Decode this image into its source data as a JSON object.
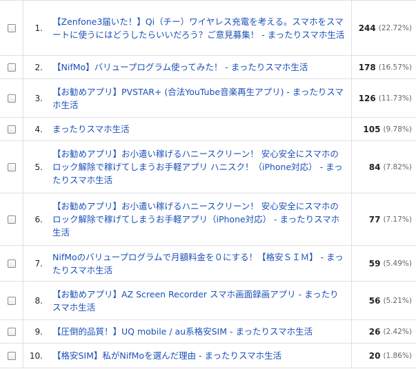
{
  "rows": [
    {
      "rank": "1.",
      "title": "【Zenfone3届いた！】Qi（チー）ワイヤレス充電を考える。スマホをスマートに使うにはどうしたらいいだろう？ご意見募集！ - まったりスマホ生活",
      "value": "244",
      "percent": "(22.72%)"
    },
    {
      "rank": "2.",
      "title": "【NifMo】バリュープログラム使ってみた！ - まったりスマホ生活",
      "value": "178",
      "percent": "(16.57%)"
    },
    {
      "rank": "3.",
      "title": "【お勧めアプリ】PVSTAR+ (合法YouTube音楽再生アプリ) - まったりスマホ生活",
      "value": "126",
      "percent": "(11.73%)"
    },
    {
      "rank": "4.",
      "title": "まったりスマホ生活",
      "value": "105",
      "percent": "(9.78%)"
    },
    {
      "rank": "5.",
      "title": "【お勧めアプリ】お小遣い稼げるハニースクリーン！ 安心安全にスマホのロック解除で稼げてしまうお手軽アプリ ハニスク！（iPhone対応） - まったりスマホ生活",
      "value": "84",
      "percent": "(7.82%)"
    },
    {
      "rank": "6.",
      "title": "【お勧めアプリ】お小遣い稼げるハニースクリーン！ 安心安全にスマホのロック解除で稼げてしまうお手軽アプリ（iPhone対応） - まったりスマホ生活",
      "value": "77",
      "percent": "(7.17%)"
    },
    {
      "rank": "7.",
      "title": "NifMoのバリュープログラムで月額料金を０にする！【格安ＳＩＭ】 - まったりスマホ生活",
      "value": "59",
      "percent": "(5.49%)"
    },
    {
      "rank": "8.",
      "title": "【お勧めアプリ】AZ Screen Recorder スマホ画面録画アプリ - まったりスマホ生活",
      "value": "56",
      "percent": "(5.21%)"
    },
    {
      "rank": "9.",
      "title": "【圧倒的品質！】UQ mobile / au系格安SIM - まったりスマホ生活",
      "value": "26",
      "percent": "(2.42%)"
    },
    {
      "rank": "10.",
      "title": "【格安SIM】私がNifMoを選んだ理由 - まったりスマホ生活",
      "value": "20",
      "percent": "(1.86%)"
    }
  ]
}
